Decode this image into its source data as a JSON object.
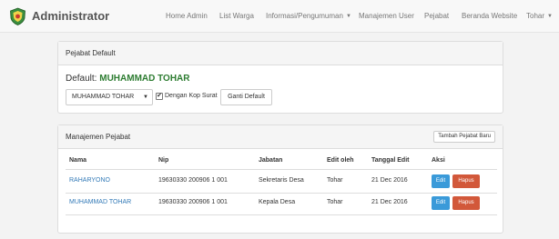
{
  "app": {
    "title": "Administrator"
  },
  "nav": {
    "items": [
      {
        "label": "Home Admin"
      },
      {
        "label": "List Warga"
      },
      {
        "label": "Informasi/Pengumuman"
      },
      {
        "label": "Manajemen User"
      },
      {
        "label": "Pejabat"
      },
      {
        "label": "Beranda Website"
      },
      {
        "label": "Tohar"
      }
    ]
  },
  "default_panel": {
    "heading": "Pejabat Default",
    "default_prefix": "Default:",
    "default_name": "MUHAMMAD TOHAR",
    "select_value": "MUHAMMAD TOHAR",
    "checkbox_checked": true,
    "checkbox_label": "Dengan Kop Surat",
    "button_label": "Ganti Default"
  },
  "manage_panel": {
    "heading": "Manajemen Pejabat",
    "add_button": "Tambah Pejabat Baru",
    "columns": [
      "Nama",
      "Nip",
      "Jabatan",
      "Edit oleh",
      "Tanggal Edit",
      "Aksi"
    ],
    "rows": [
      {
        "nama": "RAHARYONO",
        "nip": "19630330 200906 1 001",
        "jabatan": "Sekretaris Desa",
        "edit_oleh": "Tohar",
        "tanggal": "21 Dec 2016",
        "edit": "Edit",
        "hapus": "Hapus"
      },
      {
        "nama": "MUHAMMAD TOHAR",
        "nip": "19630330 200906 1 001",
        "jabatan": "Kepala Desa",
        "edit_oleh": "Tohar",
        "tanggal": "21 Dec 2016",
        "edit": "Edit",
        "hapus": "Hapus"
      }
    ]
  },
  "colors": {
    "accent": "#337ab7",
    "edit": "#3a9ad9",
    "delete": "#d2583a",
    "default_name": "#2e7d32"
  }
}
